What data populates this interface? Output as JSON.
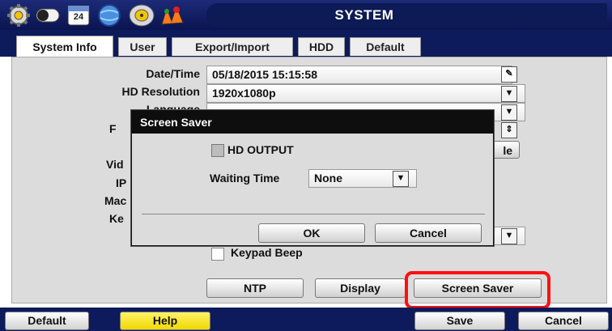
{
  "window": {
    "title": "SYSTEM"
  },
  "toolbar_icons": [
    "gear-icon",
    "toggle-icon",
    "calendar-icon",
    "globe-icon",
    "disc-icon",
    "color-palette-icon"
  ],
  "toolbar": {
    "calendar_day": "24"
  },
  "tabs": [
    {
      "label": "System Info",
      "active": true
    },
    {
      "label": "User",
      "active": false
    },
    {
      "label": "Export/Import",
      "active": false
    },
    {
      "label": "HDD",
      "active": false
    },
    {
      "label": "Default",
      "active": false
    }
  ],
  "form": {
    "datetime_label": "Date/Time",
    "datetime_value": "05/18/2015 15:15:58",
    "resolution_label": "HD Resolution",
    "resolution_value": "1920x1080p",
    "language_label": "Language",
    "partial_f": "F",
    "partial_vid": "Vid",
    "partial_ip": "IP",
    "partial_mac": "Mac",
    "partial_ke": "Ke",
    "partial_button_tail": "le",
    "keypad_beep_label": "Keypad Beep",
    "keypad_beep_checked": false
  },
  "buttons": {
    "ntp": "NTP",
    "display": "Display",
    "screen_saver": "Screen Saver"
  },
  "dialog": {
    "title": "Screen Saver",
    "hd_output_label": "HD OUTPUT",
    "hd_output_checked": false,
    "waiting_time_label": "Waiting Time",
    "waiting_time_value": "None",
    "ok_label": "OK",
    "cancel_label": "Cancel"
  },
  "bottom": {
    "default_label": "Default",
    "help_label": "Help",
    "save_label": "Save",
    "cancel_label": "Cancel"
  },
  "colors": {
    "title_bar": "#0d1a5c",
    "dialog_title": "#0e0e0e",
    "highlight": "#ff1010",
    "help_button": "#f0d800"
  }
}
